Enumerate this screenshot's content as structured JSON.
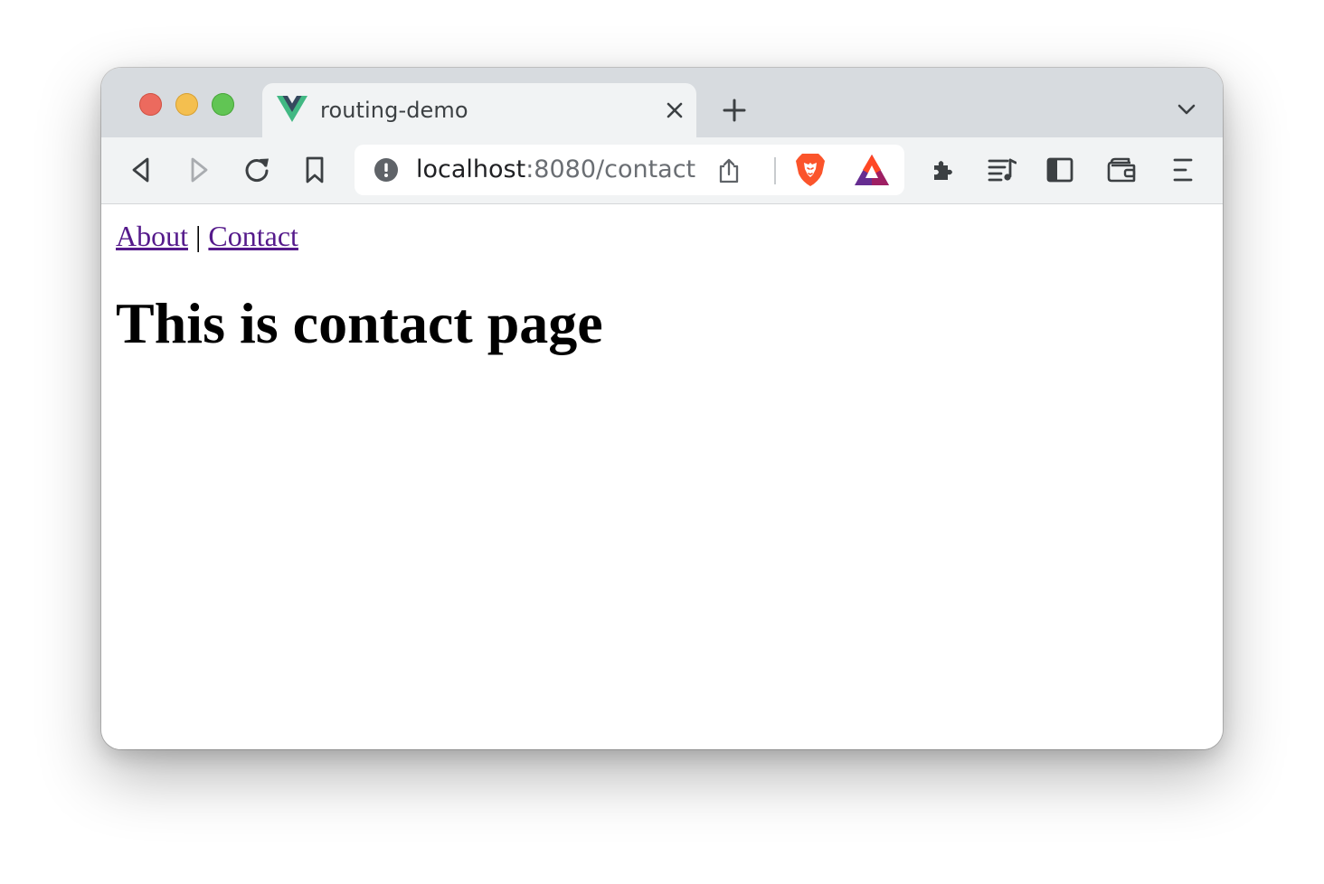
{
  "window": {
    "traffic_lights": {
      "close": "#ec6a5e",
      "minimize": "#f4bf4f",
      "zoom": "#61c554"
    }
  },
  "tab": {
    "title": "routing-demo",
    "favicon": "vue-logo-icon",
    "favicon_colors": {
      "outer": "#41b883",
      "inner": "#35495e"
    }
  },
  "toolbar": {
    "icons": [
      "back-icon",
      "forward-icon",
      "reload-icon",
      "bookmark-icon",
      "extensions-icon",
      "playlist-icon",
      "sidebar-icon",
      "wallet-icon",
      "menu-icon"
    ]
  },
  "omnibox": {
    "url_host": "localhost",
    "url_rest": ":8080/contact",
    "brave_color": "#fb542b",
    "bat_colors": [
      "#ff4724",
      "#9e1f63",
      "#662d91"
    ]
  },
  "page": {
    "nav": {
      "about_label": "About",
      "separator": "|",
      "contact_label": "Contact",
      "link_color": "#551a8b"
    },
    "heading": "This is contact page"
  }
}
